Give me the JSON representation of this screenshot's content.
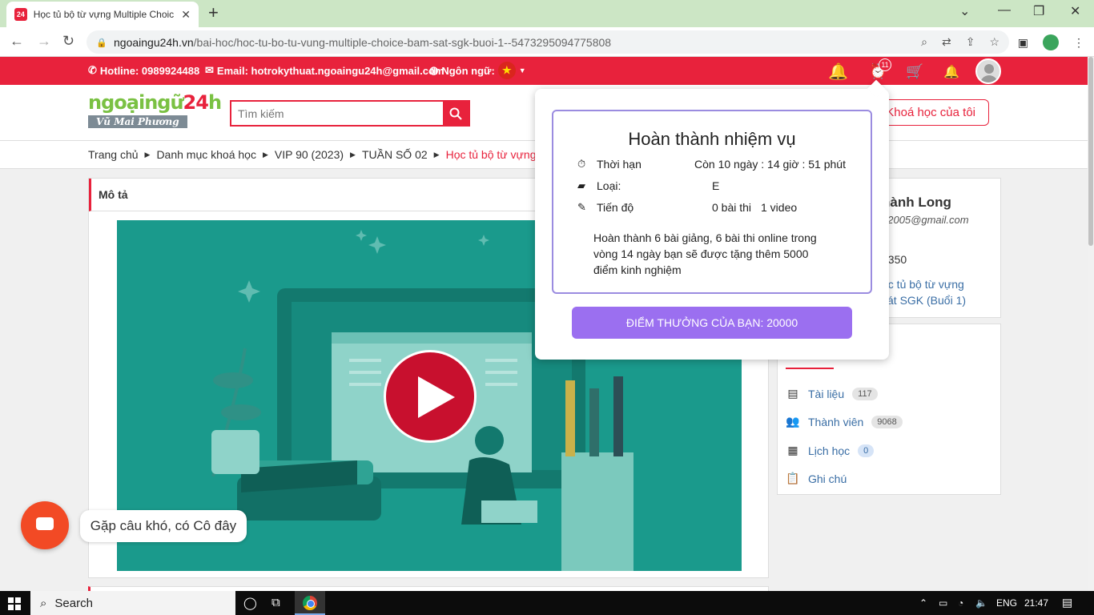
{
  "browser": {
    "tab_title": "Học tủ bộ từ vựng Multiple Choic",
    "tab_favicon": "24",
    "url_domain": "ngoaingu24h.vn",
    "url_path": "/bai-hoc/hoc-tu-bo-tu-vung-multiple-choice-bam-sat-sgk-buoi-1--5473295094775808"
  },
  "topbar": {
    "hotline": "Hotline: 0989924488",
    "email": "Email: hotrokythuat.ngoaingu24h@gmail.com",
    "language_label": "Ngôn ngữ:",
    "alarm_badge": "11"
  },
  "header": {
    "logo_text_a": "ngoại",
    "logo_text_b": "ngữ",
    "logo_text_c": "24",
    "logo_text_d": "h",
    "logo_sub": "Vũ Mai Phương",
    "search_placeholder": "Tìm kiếm",
    "my_courses": "Khoá học của tôi"
  },
  "breadcrumb": {
    "items": [
      "Trang chủ",
      "Danh mục khoá học",
      "VIP 90 (2023)",
      "TUẦN SỐ 02"
    ],
    "current": "Học tủ bộ từ vựng Multip"
  },
  "main": {
    "desc_title": "Mô tả"
  },
  "popup": {
    "title": "Hoàn thành nhiệm vụ",
    "deadline_label": "Thời hạn",
    "deadline_value": "Còn 10 ngày : 14 giờ : 51 phút",
    "type_label": "Loại:",
    "type_value": "E",
    "progress_label": "Tiến độ",
    "progress_tests": "0 bài thi",
    "progress_videos": "1 video",
    "description": "Hoàn thành 6 bài giảng, 6 bài thi online trong vòng 14 ngày bạn sẽ được tặng thêm 5000 điểm kinh nghiệm",
    "reward_button": "ĐIỂM THƯỞNG CỦA BẠN: 20000"
  },
  "profile": {
    "name": "hành Long",
    "email": "12005@gmail.com",
    "number": "6350",
    "course_line1": "ọc tủ bộ từ vựng",
    "course_line2": "sát SGK (Buổi 1)"
  },
  "stats": [
    {
      "label": "Tài liệu",
      "count": "117"
    },
    {
      "label": "Thành viên",
      "count": "9068"
    },
    {
      "label": "Lịch học",
      "count": "0"
    },
    {
      "label": "Ghi chú"
    }
  ],
  "chat": {
    "label": "Gặp câu khó, có Cô đây"
  },
  "taskbar": {
    "search": "Search",
    "lang": "ENG",
    "time": "21:47"
  },
  "colors": {
    "brand_red": "#e8223c",
    "reward_purple": "#9b6ff0",
    "chat_orange": "#f24a25"
  }
}
